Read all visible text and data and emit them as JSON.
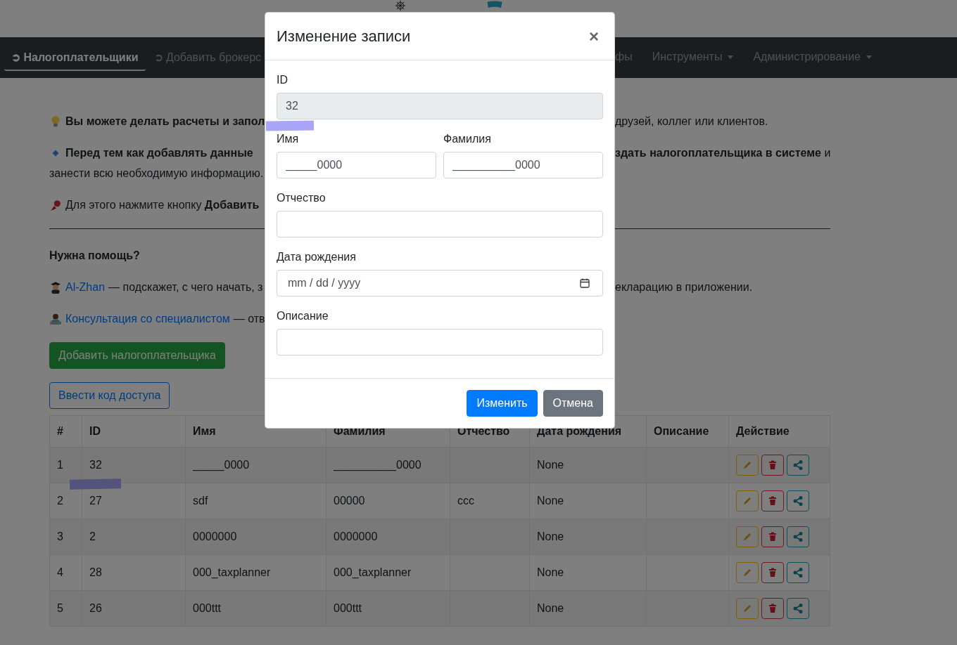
{
  "navbar": {
    "left_items": [
      {
        "label": "➲ Налогоплательщики",
        "kind": "link",
        "selected": true
      },
      {
        "label": "➲ Добавить брокерс",
        "kind": "link",
        "selected": false
      }
    ],
    "right_items": [
      {
        "label": "фы",
        "kind": "link",
        "selected": false
      },
      {
        "label": "Инструменты",
        "kind": "dropdown",
        "selected": false
      },
      {
        "label": "Администрирование",
        "kind": "dropdown",
        "selected": false
      }
    ]
  },
  "intro": [
    {
      "kind": "tip",
      "left": "**Вы можете делать расчеты и запол**",
      "right": "друзей, коллег или клиентов."
    },
    {
      "kind": "info",
      "left": "**Перед тем как добавлять данные**",
      "right": "**здать налогоплательщика в системе** и",
      "continuation": "занести всю необходимую информацию."
    },
    {
      "kind": "pin",
      "left": "Для этого нажмите кнопку **Добавить**"
    }
  ],
  "help": {
    "heading": "Нужна помощь?",
    "lines": [
      {
        "kind": "assistant",
        "link": "Al-Zhan",
        "left": "— подскажет, с чего начать, з",
        "right": "екларацию в приложении."
      },
      {
        "kind": "expert",
        "link": "Консультация со специалистом",
        "left": "— отв"
      }
    ]
  },
  "buttons": [
    {
      "label": "Добавить налогоплательщика",
      "kind": "success"
    },
    {
      "label": "Ввести код доступа",
      "kind": "outline"
    }
  ],
  "table": {
    "columns": [
      "#",
      "ID",
      "Имя",
      "Фамилия",
      "Отчество",
      "Дата рождения",
      "Описание",
      "Действие"
    ],
    "rows": [
      [
        "1",
        "32",
        "_____0000",
        "__________0000",
        null,
        "None",
        null
      ],
      [
        "2",
        "27",
        "sdf",
        "00000",
        "ccc",
        "None",
        null
      ],
      [
        "3",
        "2",
        "0000000",
        "0000000",
        null,
        "None",
        null
      ],
      [
        "4",
        "28",
        "000_taxplanner",
        "000_taxplanner",
        null,
        "None",
        null
      ],
      [
        "5",
        "26",
        "000ttt",
        "000ttt",
        null,
        "None",
        null
      ]
    ],
    "row_actions": [
      {
        "kind": "edit"
      },
      {
        "kind": "delete"
      },
      {
        "kind": "share"
      }
    ]
  },
  "dialog": {
    "title": "Изменение записи",
    "close": "×",
    "rows": [
      [
        {
          "label": "ID",
          "kind": "text",
          "value": "32",
          "disabled": true
        }
      ],
      [
        {
          "label": "Имя",
          "kind": "text",
          "value": "_____0000",
          "disabled": false
        },
        {
          "label": "Фамилия",
          "kind": "text",
          "value": "__________0000",
          "disabled": false
        }
      ],
      [
        {
          "label": "Отчество",
          "kind": "text",
          "disabled": false
        }
      ],
      [
        {
          "label": "Дата рождения",
          "kind": "date",
          "placeholder": "mm / dd / yyyy",
          "disabled": false
        }
      ],
      [
        {
          "label": "Описание",
          "kind": "text",
          "disabled": false
        }
      ]
    ],
    "buttons": [
      {
        "label": "Изменить",
        "kind": "primary"
      },
      {
        "label": "Отмена",
        "kind": "secondary"
      }
    ]
  }
}
